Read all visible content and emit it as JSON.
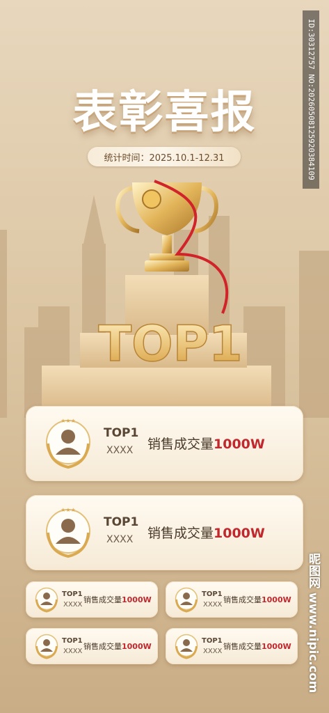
{
  "poster": {
    "title": "表彰喜报",
    "stat_period": "统计时间：2025.10.1-12.31",
    "trophy_text": "TOP1",
    "watermark_id": "ID:30312757 NO:20260508125920384109",
    "watermark_site": "昵图网 www.nipic.com"
  },
  "cards": [
    {
      "rank": "TOP1",
      "name": "XXXX",
      "sales_label": "销售成交量",
      "sales_value": "1000W"
    },
    {
      "rank": "TOP1",
      "name": "XXXX",
      "sales_label": "销售成交量",
      "sales_value": "1000W"
    },
    {
      "rank": "TOP1",
      "name": "XXXX",
      "sales_label": "销售成交量",
      "sales_value": "1000W"
    },
    {
      "rank": "TOP1",
      "name": "XXXX",
      "sales_label": "销售成交量",
      "sales_value": "1000W"
    },
    {
      "rank": "TOP1",
      "name": "XXXX",
      "sales_label": "销售成交量",
      "sales_value": "1000W"
    },
    {
      "rank": "TOP1",
      "name": "XXXX",
      "sales_label": "销售成交量",
      "sales_value": "1000W"
    }
  ],
  "colors": {
    "background": "#dcc6a3",
    "accent_red": "#c0282e",
    "gold": "#d4a24c",
    "card": "#fbf3e5"
  }
}
